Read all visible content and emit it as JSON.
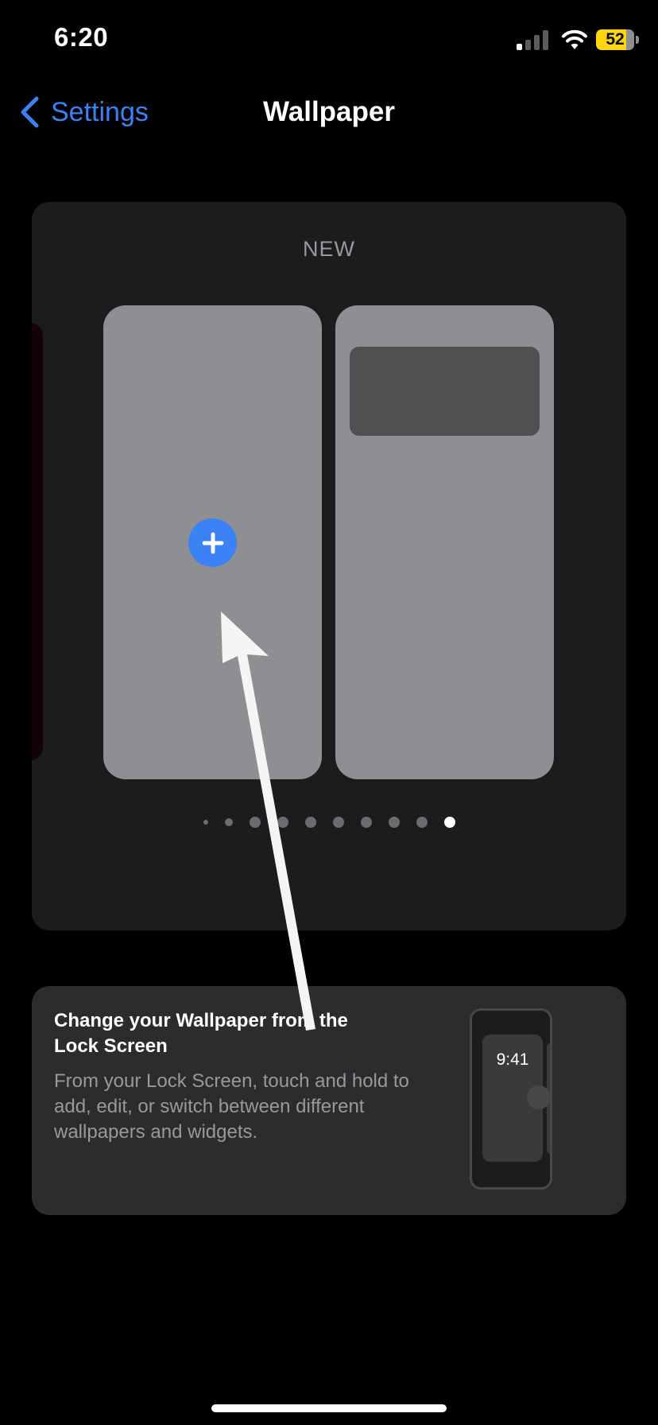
{
  "status_bar": {
    "time": "6:20",
    "battery_level": "52",
    "signal_bars_active": 1,
    "signal_bars_total": 4,
    "icons": [
      "signal-icon",
      "wifi-icon",
      "battery-icon"
    ]
  },
  "nav": {
    "back_label": "Settings",
    "back_icon": "chevron-left-icon",
    "title": "Wallpaper"
  },
  "wallpaper_section": {
    "label": "NEW",
    "add_icon": "plus-icon",
    "page_count": 10,
    "active_page": 10
  },
  "tip": {
    "title": "Change your Wallpaper from the Lock Screen",
    "body": "From your Lock Screen, touch and hold to add, edit, or switch between different wallpapers and widgets.",
    "illustration_clock": "9:41"
  },
  "colors": {
    "accent": "#3b82f6",
    "background": "#000000",
    "card": "#1c1c1e",
    "tip_card": "#2c2c2e",
    "preview": "#8e8e93",
    "battery": "#ffd60a"
  }
}
